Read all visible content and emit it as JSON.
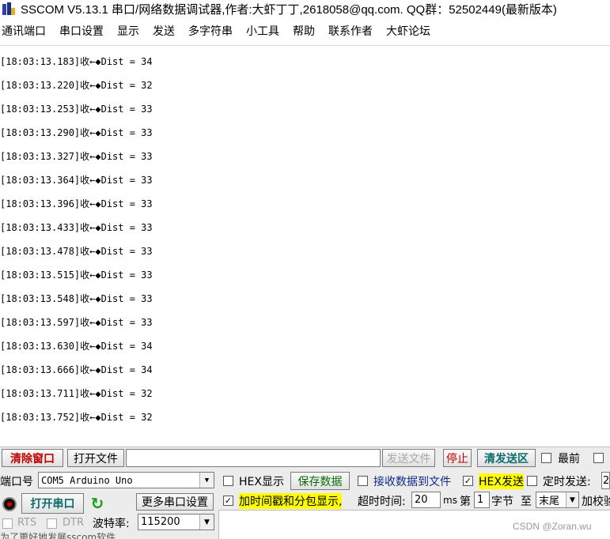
{
  "title": "SSCOM V5.13.1 串口/网络数据调试器,作者:大虾丁丁,2618058@qq.com. QQ群：52502449(最新版本)",
  "menu": [
    "通讯端口",
    "串口设置",
    "显示",
    "发送",
    "多字符串",
    "小工具",
    "帮助",
    "联系作者",
    "大虾论坛"
  ],
  "receive_lines": [
    "[18:03:13.183]收←◆Dist = 34",
    "[18:03:13.220]收←◆Dist = 32",
    "[18:03:13.253]收←◆Dist = 33",
    "[18:03:13.290]收←◆Dist = 33",
    "[18:03:13.327]收←◆Dist = 33",
    "[18:03:13.364]收←◆Dist = 33",
    "[18:03:13.396]收←◆Dist = 33",
    "[18:03:13.433]收←◆Dist = 33",
    "[18:03:13.478]收←◆Dist = 33",
    "[18:03:13.515]收←◆Dist = 33",
    "[18:03:13.548]收←◆Dist = 33",
    "[18:03:13.597]收←◆Dist = 33",
    "[18:03:13.630]收←◆Dist = 34",
    "[18:03:13.666]收←◆Dist = 34",
    "[18:03:13.711]收←◆Dist = 32",
    "[18:03:13.752]收←◆Dist = 32"
  ],
  "toolbar": {
    "clear_window": "清除窗口",
    "open_file": "打开文件",
    "file_path": "",
    "send_file": "发送文件",
    "stop": "停止",
    "clear_send": "清发送区",
    "topmost_label": "最前",
    "topmost_checked": false
  },
  "port": {
    "label": "端口号",
    "value": "COM5 Arduino Uno",
    "open_button": "打开串口",
    "more_settings": "更多串口设置",
    "rts_label": "RTS",
    "dtr_label": "DTR",
    "baud_label": "波特率:",
    "baud_value": "115200",
    "bottom_hint": "为了更好地发展sscom软件"
  },
  "options": {
    "hex_display": "HEX显示",
    "hex_display_checked": false,
    "save_data": "保存数据",
    "recv_to_file": "接收数据到文件",
    "recv_to_file_checked": false,
    "hex_send": "HEX发送",
    "hex_send_checked": true,
    "timed_send": "定时发送:",
    "timed_send_checked": false,
    "timed_value": "2",
    "timestamp": "加时间戳和分包显示,",
    "timestamp_checked": true,
    "timeout_label": "超时时间:",
    "timeout_value": "20",
    "timeout_unit": "ms",
    "byte_prefix": "第",
    "byte_value": "1",
    "byte_suffix": "字节",
    "to_label": "至",
    "end_select": "末尾",
    "checksum_label": "加校验"
  },
  "watermark": "CSDN @Zoran.wu"
}
